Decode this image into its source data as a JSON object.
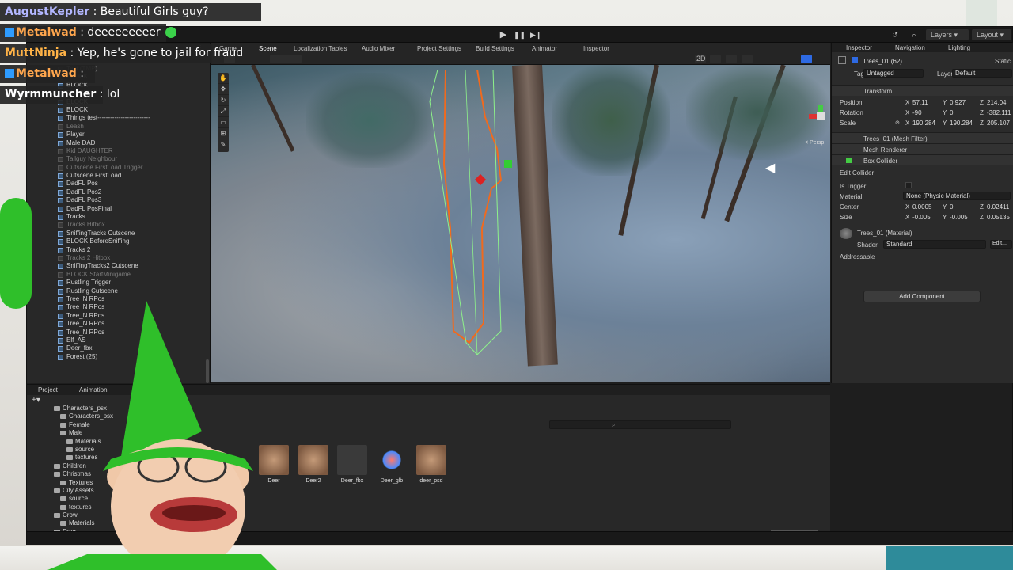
{
  "colors": {
    "accent": "#2e6ae3",
    "selection_orange": "#f06a1e",
    "collider_green": "#8ef28a",
    "gnome_green": "#2fbf2a"
  },
  "chat": [
    {
      "user": "AugustKepler",
      "message": "Beautiful Girls guy?",
      "user_color": "#b3b7ff"
    },
    {
      "user": "Metalwad",
      "message": "deeeeeeeeer",
      "user_color": "#ffa64d",
      "icon": "emote-icon"
    },
    {
      "user": "MuttNinja",
      "message": "Yep, he's gone to jail for fraud",
      "user_color": "#ffb347"
    },
    {
      "user": "Metalwad",
      "message": "",
      "user_color": "#ffa64d"
    },
    {
      "user": "Wyrmmuncher",
      "message": "lol",
      "user_color": "#ffffff"
    }
  ],
  "toolbar": {
    "layers": "Layers",
    "layout": "Layout"
  },
  "scene_tabs": [
    {
      "label": "Game"
    },
    {
      "label": "Scene"
    },
    {
      "label": "Localization Tables"
    },
    {
      "label": "Audio Mixer"
    },
    {
      "label": "Project Settings"
    },
    {
      "label": "Build Settings"
    },
    {
      "label": "Animator"
    },
    {
      "label": "Inspector"
    }
  ],
  "scene": {
    "mode_2d": "2D",
    "persp": "< Persp"
  },
  "hierarchy": {
    "items": [
      {
        "label": "Text (TMP)",
        "dim": true
      },
      {
        "label": "BLOCK",
        "dim": true
      },
      {
        "label": "BLOCK",
        "dim": false
      },
      {
        "label": "BLOCK",
        "dim": false
      },
      {
        "label": "BLOCK",
        "dim": false
      },
      {
        "label": "BLOCK",
        "dim": false
      },
      {
        "label": "Things test-------------------------",
        "dim": false
      },
      {
        "label": "Leash",
        "dim": true
      },
      {
        "label": "Player",
        "dim": false
      },
      {
        "label": "Male DAD",
        "dim": false
      },
      {
        "label": "Kid DAUGHTER",
        "dim": true
      },
      {
        "label": "Tailguy Neighbour",
        "dim": true
      },
      {
        "label": "Cutscene FirstLoad Trigger",
        "dim": true
      },
      {
        "label": "Cutscene FirstLoad",
        "dim": false
      },
      {
        "label": "DadFL Pos",
        "dim": false
      },
      {
        "label": "DadFL Pos2",
        "dim": false
      },
      {
        "label": "DadFL Pos3",
        "dim": false
      },
      {
        "label": "DadFL PosFinal",
        "dim": false
      },
      {
        "label": "Tracks",
        "dim": false
      },
      {
        "label": "Tracks Hitbox",
        "dim": true
      },
      {
        "label": "SniffingTracks Cutscene",
        "dim": false
      },
      {
        "label": "BLOCK BeforeSniffing",
        "dim": false
      },
      {
        "label": "Tracks 2",
        "dim": false
      },
      {
        "label": "Tracks 2 Hitbox",
        "dim": true
      },
      {
        "label": "SniffingTracks2 Cutscene",
        "dim": false
      },
      {
        "label": "BLOCK StartMinigame",
        "dim": true
      },
      {
        "label": "Rustling Trigger",
        "dim": false
      },
      {
        "label": "Rustling Cutscene",
        "dim": false
      },
      {
        "label": "Tree_N RPos",
        "dim": false
      },
      {
        "label": "Tree_N RPos",
        "dim": false
      },
      {
        "label": "Tree_N RPos",
        "dim": false
      },
      {
        "label": "Tree_N RPos",
        "dim": false
      },
      {
        "label": "Tree_N RPos",
        "dim": false
      },
      {
        "label": "Elf_AS",
        "dim": false
      },
      {
        "label": "Deer_fbx",
        "dim": false
      },
      {
        "label": "Forest (25)",
        "dim": false
      }
    ]
  },
  "inspector": {
    "tabs": [
      "Inspector",
      "Navigation",
      "Lighting"
    ],
    "object_name": "Trees_01 (62)",
    "static_label": "Static",
    "tag_label": "Tag",
    "tag_value": "Untagged",
    "layer_label": "Layer",
    "layer_value": "Default",
    "transform": {
      "header": "Transform",
      "position_label": "Position",
      "pos_x": "57.11",
      "pos_y": "0.927",
      "pos_z": "214.04",
      "rotation_label": "Rotation",
      "rot_x": "-90",
      "rot_y": "0",
      "rot_z": "-382.111",
      "scale_label": "Scale",
      "scale_x": "190.284",
      "scale_y": "190.284",
      "scale_z": "205.107"
    },
    "mesh_filter": "Trees_01 (Mesh Filter)",
    "mesh_renderer": "Mesh Renderer",
    "box_collider": {
      "header": "Box Collider",
      "edit": "Edit Collider",
      "is_trigger": "Is Trigger",
      "material_label": "Material",
      "material_value": "None (Physic Material)",
      "center_label": "Center",
      "c_x": "0.0005",
      "c_y": "0",
      "c_z": "0.02411",
      "size_label": "Size",
      "s_x": "-0.005",
      "s_y": "-0.005",
      "s_z": "0.05135"
    },
    "material": {
      "name": "Trees_01 (Material)",
      "shader_label": "Shader",
      "shader_value": "Standard",
      "edit": "Edit..."
    },
    "addressable": "Addressable",
    "add_component": "Add Component",
    "axis_x": "X",
    "axis_y": "Y",
    "axis_z": "Z"
  },
  "project": {
    "tabs": [
      "Project",
      "Animation"
    ],
    "tree": [
      {
        "label": "Characters_psx",
        "indent": 1
      },
      {
        "label": "Characters_psx",
        "indent": 2
      },
      {
        "label": "Female",
        "indent": 2
      },
      {
        "label": "Male",
        "indent": 2
      },
      {
        "label": "Materials",
        "indent": 3
      },
      {
        "label": "source",
        "indent": 3
      },
      {
        "label": "textures",
        "indent": 3
      },
      {
        "label": "Children",
        "indent": 1
      },
      {
        "label": "Christmas",
        "indent": 1
      },
      {
        "label": "Textures",
        "indent": 2
      },
      {
        "label": "City Assets",
        "indent": 1
      },
      {
        "label": "source",
        "indent": 2
      },
      {
        "label": "textures",
        "indent": 2
      },
      {
        "label": "Crow",
        "indent": 1
      },
      {
        "label": "Materials",
        "indent": 2
      },
      {
        "label": "Deer",
        "indent": 1
      }
    ],
    "assets": [
      "Deer",
      "Deer2",
      "Deer_fbx",
      "Deer_glb",
      "deer_psd"
    ]
  }
}
